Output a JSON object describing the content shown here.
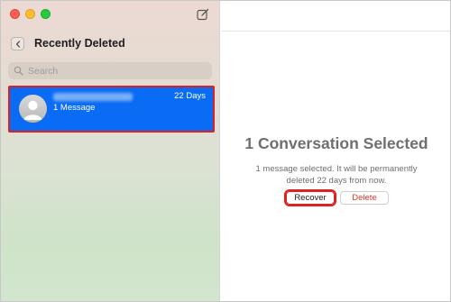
{
  "colors": {
    "accent": "#0a6cf5",
    "highlight_outline": "#e02020",
    "delete_text": "#e0392b"
  },
  "sidebar": {
    "title": "Recently Deleted",
    "search_placeholder": "Search",
    "conversations": [
      {
        "days": "22 Days",
        "message_count": "1 Message"
      }
    ]
  },
  "main": {
    "heading": "1 Conversation Selected",
    "description_line1": "1 message selected. It will be permanently",
    "description_line2": "deleted 22 days from now.",
    "recover_label": "Recover",
    "delete_label": "Delete"
  }
}
